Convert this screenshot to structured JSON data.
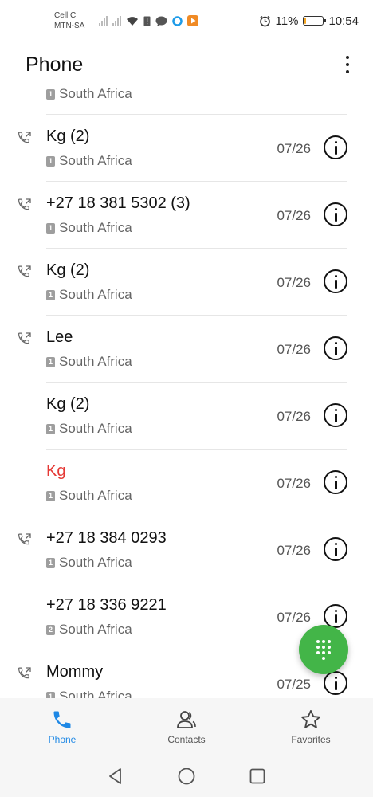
{
  "status_bar": {
    "carrier_line1": "Cell C",
    "carrier_line2": "MTN-SA",
    "battery_percent": "11%",
    "battery_level": 0.11,
    "time": "10:54"
  },
  "header": {
    "title": "Phone"
  },
  "calls": [
    {
      "name": "",
      "location": "South Africa",
      "sim": "1",
      "date": "",
      "type": "outgoing",
      "missed": false
    },
    {
      "name": "Kg (2)",
      "location": "South Africa",
      "sim": "1",
      "date": "07/26",
      "type": "outgoing",
      "missed": false
    },
    {
      "name": "+27 18 381 5302 (3)",
      "location": "South Africa",
      "sim": "1",
      "date": "07/26",
      "type": "outgoing",
      "missed": false
    },
    {
      "name": "Kg (2)",
      "location": "South Africa",
      "sim": "1",
      "date": "07/26",
      "type": "outgoing",
      "missed": false
    },
    {
      "name": "Lee",
      "location": "South Africa",
      "sim": "1",
      "date": "07/26",
      "type": "outgoing",
      "missed": false
    },
    {
      "name": "Kg (2)",
      "location": "South Africa",
      "sim": "1",
      "date": "07/26",
      "type": "none",
      "missed": false
    },
    {
      "name": "Kg",
      "location": "South Africa",
      "sim": "1",
      "date": "07/26",
      "type": "none",
      "missed": true
    },
    {
      "name": "+27 18 384 0293",
      "location": "South Africa",
      "sim": "1",
      "date": "07/26",
      "type": "outgoing",
      "missed": false
    },
    {
      "name": "+27 18 336 9221",
      "location": "South Africa",
      "sim": "2",
      "date": "07/26",
      "type": "none",
      "missed": false
    },
    {
      "name": "Mommy",
      "location": "South Africa",
      "sim": "1",
      "date": "07/25",
      "type": "outgoing",
      "missed": false
    }
  ],
  "bottom_nav": {
    "phone_label": "Phone",
    "contacts_label": "Contacts",
    "favorites_label": "Favorites"
  },
  "colors": {
    "accent": "#1e88e5",
    "missed": "#e53935",
    "fab": "#43b548"
  }
}
